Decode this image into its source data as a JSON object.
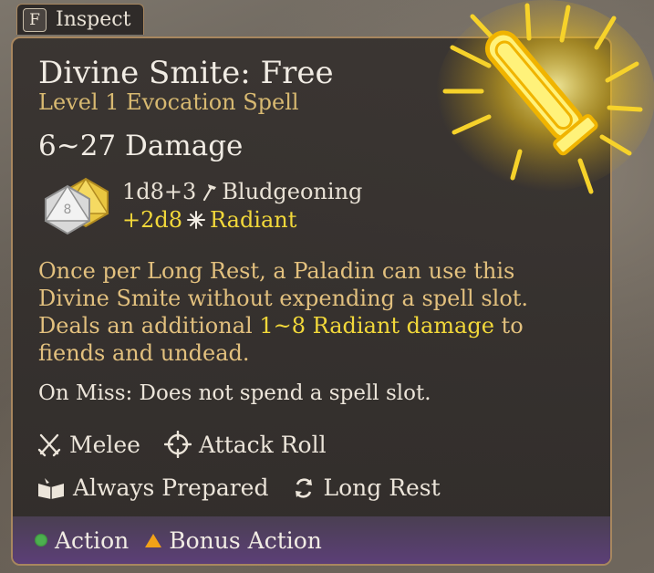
{
  "inspect": {
    "key": "F",
    "label": "Inspect"
  },
  "spell": {
    "title": "Divine Smite: Free",
    "subtitle": "Level 1 Evocation Spell",
    "damage": "6~27 Damage",
    "damage_lines": [
      {
        "dice": "1d8+3",
        "type": "Bludgeoning",
        "icon": "hammer-icon"
      },
      {
        "dice": "+2d8",
        "type": "Radiant",
        "icon": "radiant-star-icon"
      }
    ],
    "dice_faces": [
      "8",
      "8"
    ],
    "description_part1": "Once per Long Rest, a Paladin can use this Divine Smite without expending a spell slot. Deals an additional ",
    "description_highlight": "1~8 Radiant damage",
    "description_part2": " to fiends and undead.",
    "on_miss": "On Miss: Does not spend a spell slot.",
    "tags_row1": [
      {
        "label": "Melee",
        "icon": "crossed-swords-icon"
      },
      {
        "label": "Attack Roll",
        "icon": "crosshair-icon"
      }
    ],
    "tags_row2": [
      {
        "label": "Always Prepared",
        "icon": "open-book-icon"
      },
      {
        "label": "Long Rest",
        "icon": "cycle-arrows-icon"
      }
    ],
    "costs": [
      {
        "label": "Action",
        "icon": "green-circle-icon",
        "color": "#4cb04f"
      },
      {
        "label": "Bonus Action",
        "icon": "orange-triangle-icon",
        "color": "#f2a218"
      }
    ]
  },
  "colors": {
    "gold": "#d8b971",
    "radiant": "#f2d83a",
    "border": "#a8875f",
    "footer": "#5c3f77"
  }
}
